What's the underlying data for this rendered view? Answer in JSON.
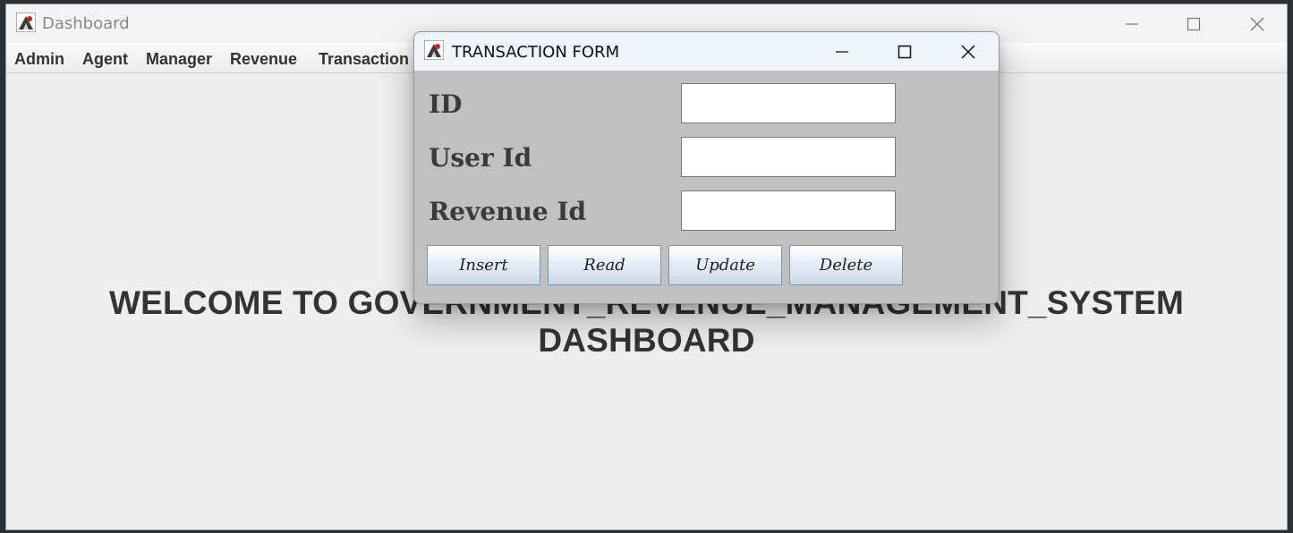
{
  "main_window": {
    "title": "Dashboard",
    "menu": [
      "Admin",
      "Agent",
      "Manager",
      "Revenue",
      "Transaction"
    ],
    "welcome_text": "WELCOME TO GOVERNMENT_REVENUE_MANAGEMENT_SYSTEM DASHBOARD",
    "controls": {
      "minimize": "minimize-icon",
      "maximize": "maximize-icon",
      "close": "close-icon"
    }
  },
  "dialog": {
    "title": "TRANSACTION FORM",
    "fields": [
      {
        "label": "ID",
        "value": ""
      },
      {
        "label": "User Id",
        "value": ""
      },
      {
        "label": "Revenue Id",
        "value": ""
      }
    ],
    "buttons": [
      "Insert",
      "Read",
      "Update",
      "Delete"
    ]
  },
  "colors": {
    "window_bg": "#eeeeee",
    "dialog_bg": "#c0c0c0",
    "dialog_titlebar": "#eef4f9",
    "button_gradient_bottom": "#c9d9ea",
    "text_dark": "#333333"
  }
}
